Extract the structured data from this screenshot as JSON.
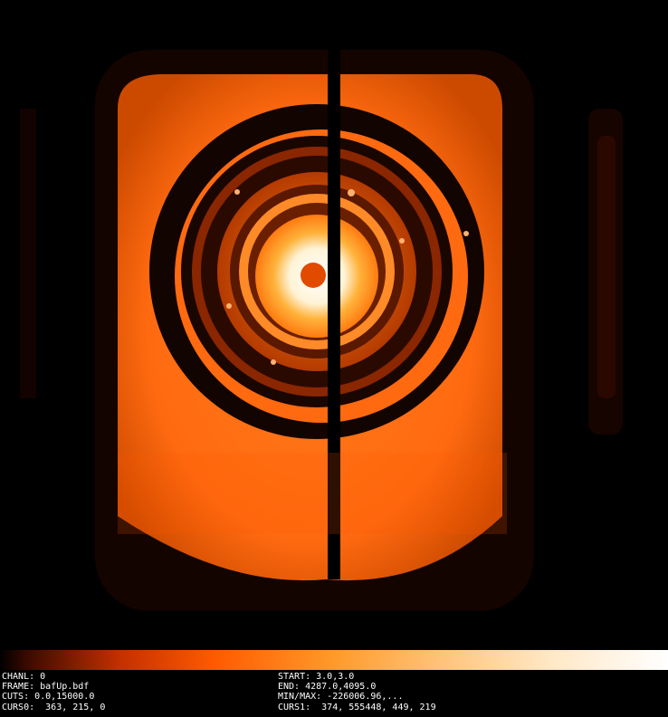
{
  "status": {
    "chanl": "CHANL: 0",
    "frame": "FRAME: bafUp.bdf",
    "cuts": "CUTS: 0.0,15000.0",
    "curs0": "CURS0:  363, 215, 0",
    "start": "START: 3.0,3.0",
    "end": "END: 4287.0,4095.0",
    "minmax": "MIN/MAX: -226006.96,...",
    "curs1": "CURS1:  374, 555448, 449, 219"
  },
  "colors": {
    "background": "#000000",
    "outer_orange": "#ff6a10",
    "dark_ring": "#1a0600",
    "hot_center": "#ffffff"
  },
  "icons": {
    "colorbar": "heat-colormap"
  }
}
